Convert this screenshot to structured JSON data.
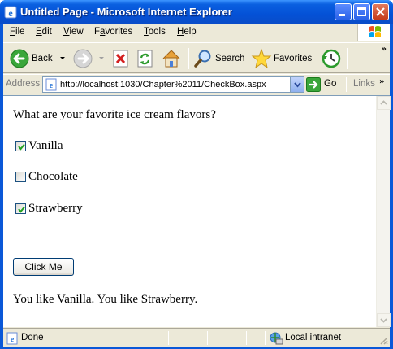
{
  "window": {
    "title": "Untitled Page - Microsoft Internet Explorer"
  },
  "menu": {
    "items": [
      {
        "label": "File",
        "mnemonic": "F",
        "rest": "ile"
      },
      {
        "label": "Edit",
        "mnemonic": "E",
        "rest": "dit"
      },
      {
        "label": "View",
        "mnemonic": "V",
        "rest": "iew"
      },
      {
        "label": "Favorites",
        "mnemonic": "a",
        "pre": "F",
        "rest": "vorites"
      },
      {
        "label": "Tools",
        "mnemonic": "T",
        "rest": "ools"
      },
      {
        "label": "Help",
        "mnemonic": "H",
        "rest": "elp"
      }
    ]
  },
  "toolbar": {
    "back_label": "Back",
    "search_label": "Search",
    "favorites_label": "Favorites",
    "overflow": "»"
  },
  "address": {
    "label": "Address",
    "url": "http://localhost:1030/Chapter%2011/CheckBox.aspx",
    "go_label": "Go",
    "links_label": "Links",
    "links_overflow": "»"
  },
  "page": {
    "question": "What are your favorite ice cream flavors?",
    "flavors": [
      {
        "label": "Vanilla",
        "checked": true
      },
      {
        "label": "Chocolate",
        "checked": false
      },
      {
        "label": "Strawberry",
        "checked": true
      }
    ],
    "button_label": "Click Me",
    "result": "You like Vanilla. You like Strawberry."
  },
  "status": {
    "text": "Done",
    "zone": "Local intranet"
  },
  "colors": {
    "titlebar": "#0451d6",
    "chrome": "#ece9d8",
    "checkmark": "#21a121"
  }
}
